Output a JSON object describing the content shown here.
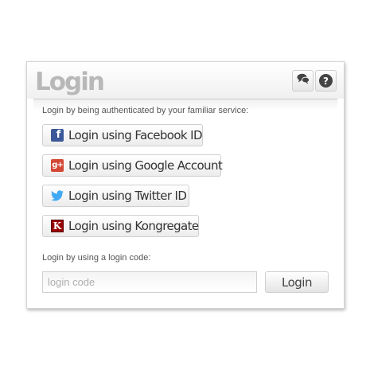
{
  "login_panel": {
    "title": "Login",
    "header_buttons": {
      "chat_icon": "chat-bubbles-icon",
      "help_icon": "question-icon",
      "help_glyph": "?"
    },
    "service_section_label": "Login by being authenticated by your familiar service:",
    "services": [
      {
        "label": "Login using Facebook ID",
        "icon": "facebook-icon",
        "icon_glyph": "f",
        "color": "#3b5998"
      },
      {
        "label": "Login using Google Account",
        "icon": "google-plus-icon",
        "icon_glyph": "g+",
        "color": "#d34836"
      },
      {
        "label": "Login using Twitter ID",
        "icon": "twitter-icon",
        "color": "#3fa9f5"
      },
      {
        "label": "Login using Kongregate",
        "icon": "kongregate-icon",
        "icon_glyph": "K",
        "color": "#990000"
      }
    ],
    "code_section_label": "Login by using a login code:",
    "code_input": {
      "value": "",
      "placeholder": "login code"
    },
    "submit_label": "Login"
  }
}
